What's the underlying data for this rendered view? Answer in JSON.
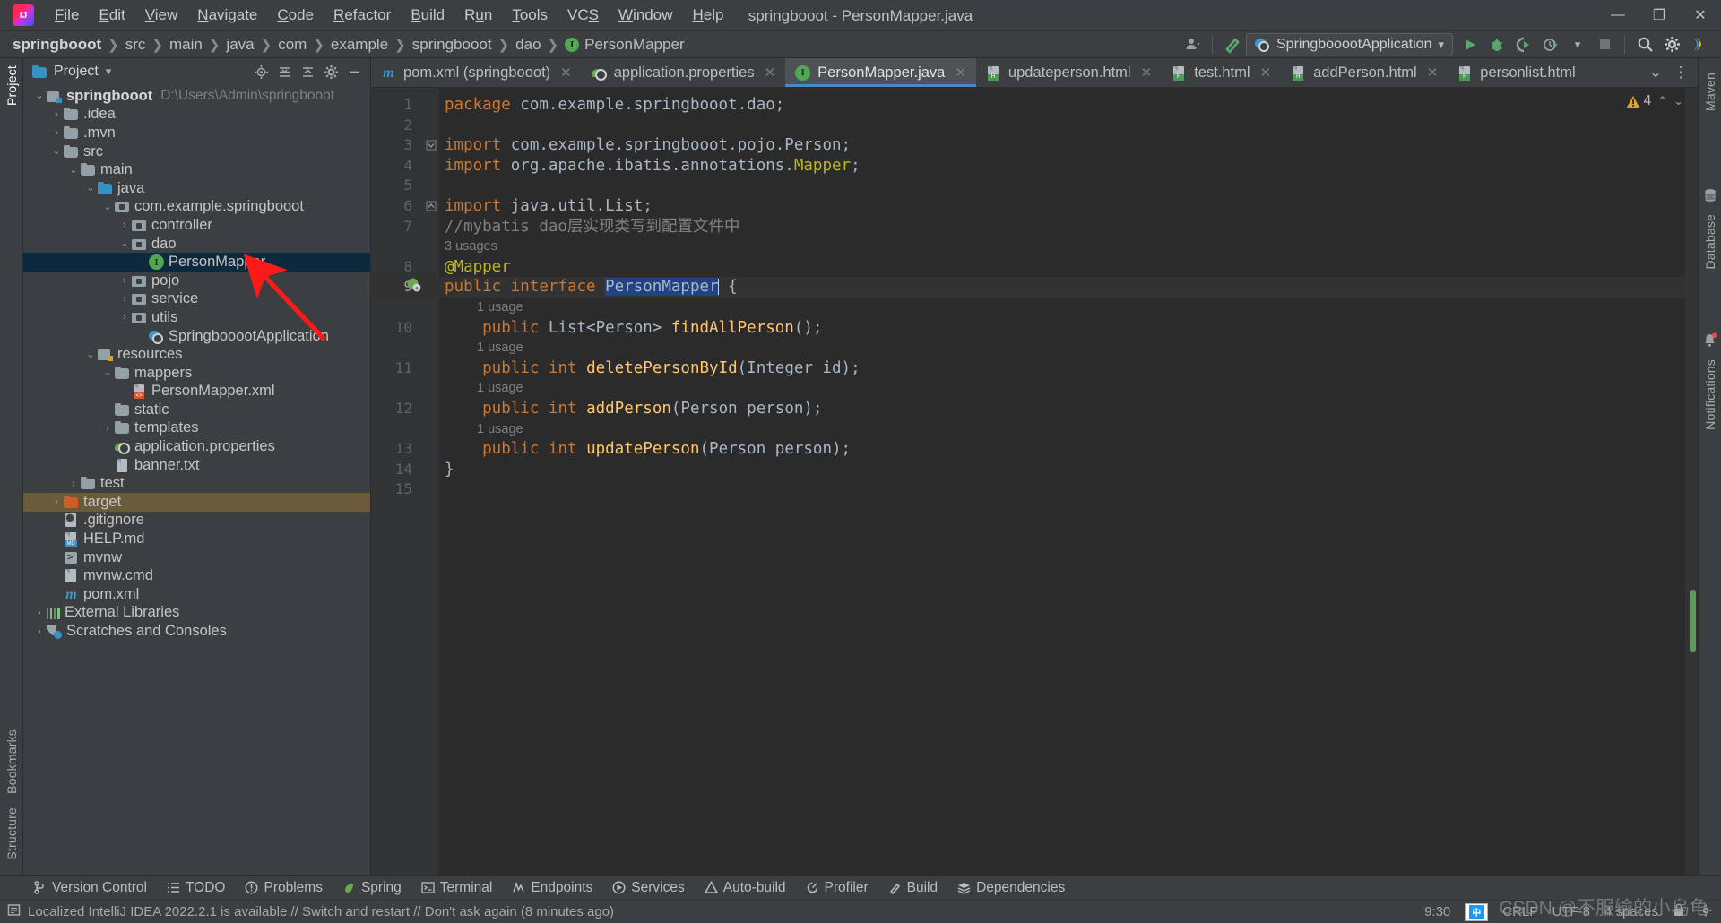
{
  "window": {
    "title": "springbooot - PersonMapper.java",
    "minimize": "—",
    "maximize": "❐",
    "close": "✕"
  },
  "menu": [
    {
      "label": "File"
    },
    {
      "label": "Edit"
    },
    {
      "label": "View"
    },
    {
      "label": "Navigate"
    },
    {
      "label": "Code"
    },
    {
      "label": "Refactor"
    },
    {
      "label": "Build"
    },
    {
      "label": "Run"
    },
    {
      "label": "Tools"
    },
    {
      "label": "VCS"
    },
    {
      "label": "Window"
    },
    {
      "label": "Help"
    }
  ],
  "breadcrumb": {
    "items": [
      "springbooot",
      "src",
      "main",
      "java",
      "com",
      "example",
      "springbooot",
      "dao",
      "PersonMapper"
    ],
    "separator": "❯",
    "file_icon_letter": "I"
  },
  "toolbar": {
    "run_config": "SpringbooootApplication",
    "run_config_caret": "▾",
    "icons": [
      "user-settings-icon",
      "build-hammer-icon",
      "run-icon",
      "debug-icon",
      "run-with-coverage-icon",
      "profiler-icon",
      "stop-icon",
      "search-everywhere-icon",
      "settings-gear-icon",
      "ide-feature-icon"
    ]
  },
  "left_strip": {
    "top_label": "Project",
    "bottom_labels": [
      "Bookmarks",
      "Structure"
    ]
  },
  "right_strip": {
    "labels": [
      "Maven",
      "Database",
      "Notifications"
    ]
  },
  "project_panel": {
    "title": "Project",
    "caret": "▾",
    "header_icons": [
      "select-opened-file-icon",
      "expand-all-icon",
      "collapse-all-icon",
      "settings-icon",
      "hide-icon"
    ],
    "tree": [
      {
        "label": "springbooot",
        "sub": "D:\\Users\\Admin\\springbooot",
        "indent": 0,
        "arrow": "down",
        "icon": "module-folder",
        "bold": true,
        "state": "normal"
      },
      {
        "label": ".idea",
        "indent": 1,
        "arrow": "right",
        "icon": "folder",
        "state": "normal"
      },
      {
        "label": ".mvn",
        "indent": 1,
        "arrow": "right",
        "icon": "folder",
        "state": "normal"
      },
      {
        "label": "src",
        "indent": 1,
        "arrow": "down",
        "icon": "folder",
        "state": "normal"
      },
      {
        "label": "main",
        "indent": 2,
        "arrow": "down",
        "icon": "folder",
        "state": "normal"
      },
      {
        "label": "java",
        "indent": 3,
        "arrow": "down",
        "icon": "folder-blue",
        "state": "normal"
      },
      {
        "label": "com.example.springbooot",
        "indent": 4,
        "arrow": "down",
        "icon": "package",
        "state": "normal"
      },
      {
        "label": "controller",
        "indent": 5,
        "arrow": "right",
        "icon": "package",
        "state": "normal"
      },
      {
        "label": "dao",
        "indent": 5,
        "arrow": "down",
        "icon": "package",
        "state": "normal"
      },
      {
        "label": "PersonMapper",
        "indent": 6,
        "arrow": "none",
        "icon": "interface",
        "state": "selected"
      },
      {
        "label": "pojo",
        "indent": 5,
        "arrow": "right",
        "icon": "package",
        "state": "normal"
      },
      {
        "label": "service",
        "indent": 5,
        "arrow": "right",
        "icon": "package",
        "state": "normal"
      },
      {
        "label": "utils",
        "indent": 5,
        "arrow": "right",
        "icon": "package",
        "state": "normal"
      },
      {
        "label": "SpringbooootApplication",
        "indent": 6,
        "arrow": "none",
        "icon": "springboot-class",
        "state": "normal"
      },
      {
        "label": "resources",
        "indent": 3,
        "arrow": "down",
        "icon": "resources-folder",
        "state": "normal"
      },
      {
        "label": "mappers",
        "indent": 4,
        "arrow": "down",
        "icon": "folder",
        "state": "normal"
      },
      {
        "label": "PersonMapper.xml",
        "indent": 5,
        "arrow": "none",
        "icon": "xml-file",
        "state": "normal"
      },
      {
        "label": "static",
        "indent": 4,
        "arrow": "none",
        "icon": "folder",
        "state": "normal"
      },
      {
        "label": "templates",
        "indent": 4,
        "arrow": "right",
        "icon": "folder",
        "state": "normal"
      },
      {
        "label": "application.properties",
        "indent": 4,
        "arrow": "none",
        "icon": "spring-properties",
        "state": "normal"
      },
      {
        "label": "banner.txt",
        "indent": 4,
        "arrow": "none",
        "icon": "text-file",
        "state": "normal"
      },
      {
        "label": "test",
        "indent": 2,
        "arrow": "right",
        "icon": "folder",
        "state": "normal"
      },
      {
        "label": "target",
        "indent": 1,
        "arrow": "right",
        "icon": "folder-orange",
        "state": "excluded"
      },
      {
        "label": ".gitignore",
        "indent": 1,
        "arrow": "none",
        "icon": "gitignore-file",
        "state": "normal"
      },
      {
        "label": "HELP.md",
        "indent": 1,
        "arrow": "none",
        "icon": "md-file",
        "state": "normal"
      },
      {
        "label": "mvnw",
        "indent": 1,
        "arrow": "none",
        "icon": "script-file",
        "state": "normal"
      },
      {
        "label": "mvnw.cmd",
        "indent": 1,
        "arrow": "none",
        "icon": "text-file",
        "state": "normal"
      },
      {
        "label": "pom.xml",
        "indent": 1,
        "arrow": "none",
        "icon": "maven-file",
        "state": "normal"
      },
      {
        "label": "External Libraries",
        "indent": 0,
        "arrow": "right",
        "icon": "library",
        "state": "normal"
      },
      {
        "label": "Scratches and Consoles",
        "indent": 0,
        "arrow": "right",
        "icon": "scratch",
        "state": "normal"
      }
    ]
  },
  "editor": {
    "tabs": [
      {
        "label": "pom.xml (springbooot)",
        "icon": "maven-file",
        "active": false,
        "closable": true
      },
      {
        "label": "application.properties",
        "icon": "spring-properties",
        "active": false,
        "closable": true
      },
      {
        "label": "PersonMapper.java",
        "icon": "interface",
        "active": true,
        "closable": true
      },
      {
        "label": "updateperson.html",
        "icon": "html-file",
        "active": false,
        "closable": true
      },
      {
        "label": "test.html",
        "icon": "html-file",
        "active": false,
        "closable": true
      },
      {
        "label": "addPerson.html",
        "icon": "html-file",
        "active": false,
        "closable": true
      },
      {
        "label": "personlist.html",
        "icon": "html-file",
        "active": false,
        "closable": false
      }
    ],
    "tab_overflow_caret": "⌄",
    "tab_more": "⋮",
    "inspections": {
      "warning_count": "4",
      "warning_icon": "warning-triangle-icon",
      "up": "⌃",
      "down": "⌄"
    },
    "lines": [
      {
        "no": "1",
        "tokens": [
          {
            "t": "package ",
            "c": "kw"
          },
          {
            "t": "com.example.springbooot.dao;",
            "c": "typ"
          }
        ]
      },
      {
        "no": "2",
        "tokens": []
      },
      {
        "no": "3",
        "fold": "collapse",
        "tokens": [
          {
            "t": "import ",
            "c": "kw"
          },
          {
            "t": "com.example.springbooot.pojo.Person;",
            "c": "typ"
          }
        ]
      },
      {
        "no": "4",
        "tokens": [
          {
            "t": "import ",
            "c": "kw"
          },
          {
            "t": "org.apache.ibatis.annotations.",
            "c": "typ"
          },
          {
            "t": "Mapper",
            "c": "ann"
          },
          {
            "t": ";",
            "c": "typ"
          }
        ]
      },
      {
        "no": "5",
        "tokens": []
      },
      {
        "no": "6",
        "fold": "expand",
        "tokens": [
          {
            "t": "import ",
            "c": "kw"
          },
          {
            "t": "java.util.List;",
            "c": "typ"
          }
        ]
      },
      {
        "no": "7",
        "tokens": [
          {
            "t": "//mybatis dao层实现类写到配置文件中",
            "c": "cmt"
          }
        ]
      },
      {
        "no": "",
        "hint": "3 usages"
      },
      {
        "no": "8",
        "tokens": [
          {
            "t": "@Mapper",
            "c": "ann"
          }
        ]
      },
      {
        "no": "9",
        "current": true,
        "gutter_icon": "spring-bean-icon",
        "tokens": [
          {
            "t": "public ",
            "c": "kw"
          },
          {
            "t": "interface ",
            "c": "kw"
          },
          {
            "t": "PersonMapper",
            "c": "sel"
          },
          {
            "t": " {",
            "c": "typ"
          }
        ]
      },
      {
        "no": "",
        "hint": "1 usage",
        "hint_indent": 1
      },
      {
        "no": "10",
        "tokens": [
          {
            "t": "    public ",
            "c": "kw"
          },
          {
            "t": "List<Person> ",
            "c": "typ"
          },
          {
            "t": "findAllPerson",
            "c": "mth"
          },
          {
            "t": "();",
            "c": "typ"
          }
        ]
      },
      {
        "no": "",
        "hint": "1 usage",
        "hint_indent": 1
      },
      {
        "no": "11",
        "tokens": [
          {
            "t": "    public ",
            "c": "kw"
          },
          {
            "t": "int ",
            "c": "kw"
          },
          {
            "t": "deletePersonById",
            "c": "mth"
          },
          {
            "t": "(Integer id);",
            "c": "typ"
          }
        ]
      },
      {
        "no": "",
        "hint": "1 usage",
        "hint_indent": 1
      },
      {
        "no": "12",
        "tokens": [
          {
            "t": "    public ",
            "c": "kw"
          },
          {
            "t": "int ",
            "c": "kw"
          },
          {
            "t": "addPerson",
            "c": "mth"
          },
          {
            "t": "(Person person);",
            "c": "typ"
          }
        ]
      },
      {
        "no": "",
        "hint": "1 usage",
        "hint_indent": 1
      },
      {
        "no": "13",
        "tokens": [
          {
            "t": "    public ",
            "c": "kw"
          },
          {
            "t": "int ",
            "c": "kw"
          },
          {
            "t": "updatePerson",
            "c": "mth"
          },
          {
            "t": "(Person person);",
            "c": "typ"
          }
        ]
      },
      {
        "no": "14",
        "tokens": [
          {
            "t": "}",
            "c": "typ"
          }
        ]
      },
      {
        "no": "15",
        "tokens": []
      }
    ]
  },
  "tool_windows": [
    {
      "label": "Version Control",
      "icon": "branch-icon"
    },
    {
      "label": "TODO",
      "icon": "list-icon"
    },
    {
      "label": "Problems",
      "icon": "problems-icon"
    },
    {
      "label": "Spring",
      "icon": "spring-leaf-icon"
    },
    {
      "label": "Terminal",
      "icon": "terminal-icon"
    },
    {
      "label": "Endpoints",
      "icon": "endpoints-icon"
    },
    {
      "label": "Services",
      "icon": "services-icon"
    },
    {
      "label": "Auto-build",
      "icon": "auto-build-icon"
    },
    {
      "label": "Profiler",
      "icon": "profiler-icon"
    },
    {
      "label": "Build",
      "icon": "hammer-icon"
    },
    {
      "label": "Dependencies",
      "icon": "layers-icon"
    }
  ],
  "status_bar": {
    "message": "Localized IntelliJ IDEA 2022.2.1 is available // Switch and restart // Don't ask again (8 minutes ago)",
    "position": "9:30",
    "line_separator": "CRLF",
    "encoding": "UTF-8",
    "indent": "4 spaces",
    "ime_label": "中",
    "watermark": "CSDN @不服输的小乌龟"
  },
  "colors": {
    "accent": "#4a88c7",
    "selection": "#214283",
    "tree_selection": "#0d293e",
    "excluded": "#6b5b3a",
    "warning": "#d9a22a",
    "annotation_arrow": "#ff1a1a"
  }
}
